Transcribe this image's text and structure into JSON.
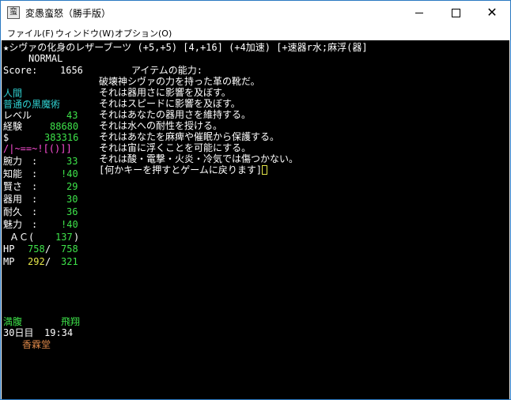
{
  "window": {
    "title": "変愚蛮怒（勝手版）",
    "icon_glyph": "蛮"
  },
  "menu": [
    {
      "label": "ファイル(F)"
    },
    {
      "label": "ウィンドウ(W)"
    },
    {
      "label": "オプション(O)"
    }
  ],
  "header": {
    "item_line": "★シヴァの化身のレザーブーツ (+5,+5) [4,+16] (+4加速) [+速器r水;麻浮(器]",
    "difficulty": "NORMAL"
  },
  "score": {
    "label": "Score:",
    "value": "1656"
  },
  "character": {
    "race": "人間",
    "class": "普通の黒魔術",
    "level": {
      "label": "レベル",
      "value": "43"
    },
    "exp": {
      "label": "経験",
      "value": "88680"
    },
    "gold": {
      "label": "$",
      "value": "383316"
    },
    "equip_chars": "/|~==~![()]]",
    "stats": [
      {
        "label": "腕力",
        "value": "33"
      },
      {
        "label": "知能",
        "value": "!40"
      },
      {
        "label": "賢さ",
        "value": "29"
      },
      {
        "label": "器用",
        "value": "30"
      },
      {
        "label": "耐久",
        "value": "36"
      },
      {
        "label": "魅力",
        "value": "!40"
      }
    ],
    "ac": {
      "label": "ＡＣ(",
      "value": "137",
      "close": ")"
    },
    "hp": {
      "label": "HP",
      "current": "758",
      "max": "758"
    },
    "mp": {
      "label": "MP",
      "current": "292",
      "max": "321"
    },
    "status": {
      "hunger": "満腹",
      "flying": "飛翔"
    },
    "time": {
      "day": "30日目",
      "clock": "19:34"
    },
    "location": "香霖堂"
  },
  "item_info": {
    "heading": "アイテムの能力:",
    "lines": [
      "破壊神シヴァの力を持った革の靴だ。",
      "それは器用さに影響を及ぼす。",
      "それはスピードに影響を及ぼす。",
      "それはあなたの器用さを維持する。",
      "それは水への耐性を授ける。",
      "それはあなたを麻痺や催眠から保護する。",
      "それは宙に浮くことを可能にする。",
      "それは酸・電撃・火炎・冷気では傷つかない。"
    ],
    "prompt": "[何かキーを押すとゲームに戻ります]"
  }
}
